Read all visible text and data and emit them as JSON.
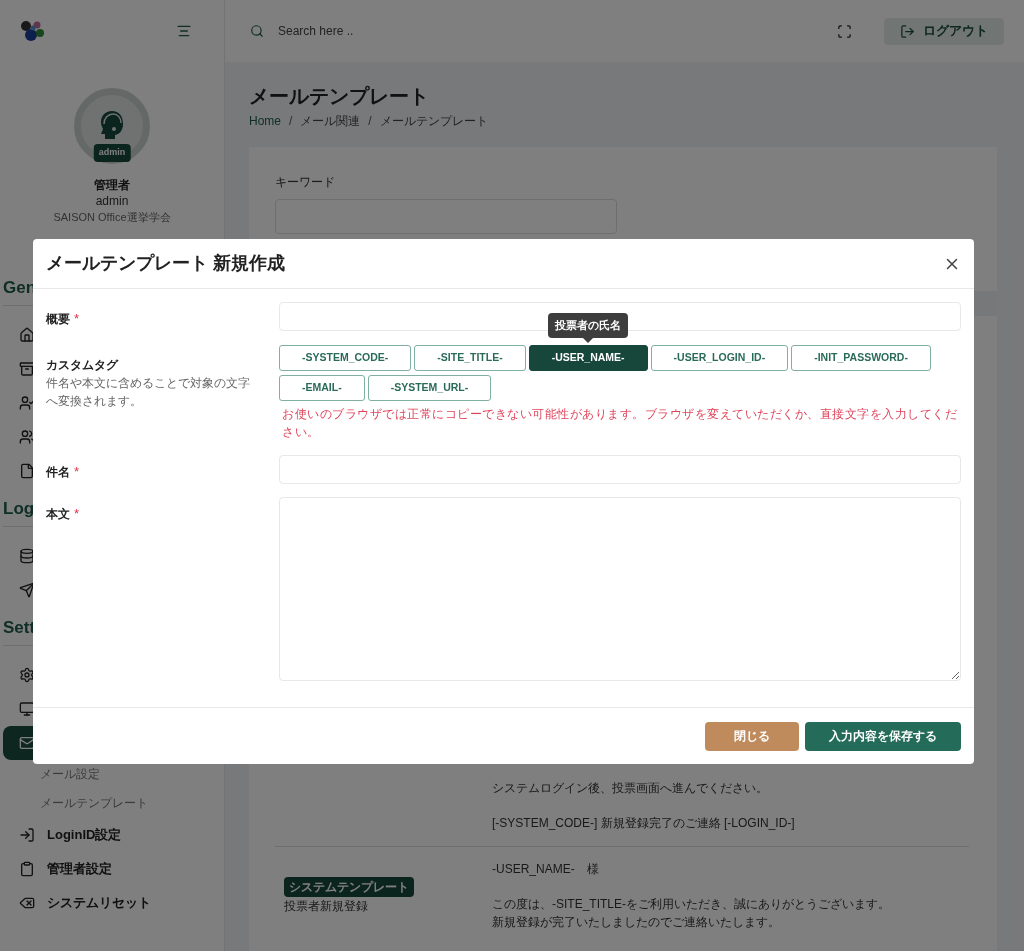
{
  "sidebar": {
    "profile": {
      "badge": "admin",
      "name": "管理者",
      "username": "admin",
      "organization": "SAISON Office選挙学会"
    },
    "sections": [
      {
        "title": "Gen",
        "items": [
          {
            "selected": false
          },
          {
            "selected": false
          },
          {
            "selected": false
          },
          {
            "selected": false
          },
          {
            "selected": false
          }
        ]
      },
      {
        "title": "Log",
        "items": [
          {
            "selected": false
          },
          {
            "selected": false
          }
        ]
      },
      {
        "title": "Sett",
        "items": [
          {
            "selected": false
          },
          {
            "selected": false
          },
          {
            "selected": true,
            "children": [
              {
                "label": "メール設定"
              },
              {
                "label": "メールテンプレート"
              }
            ]
          },
          {
            "label": "LoginID設定",
            "selected": false
          },
          {
            "label": "管理者設定",
            "selected": false
          },
          {
            "label": "システムリセット",
            "selected": false
          }
        ]
      }
    ]
  },
  "header": {
    "search_placeholder": "Search here ..",
    "logout": "ログアウト"
  },
  "page": {
    "title": "メールテンプレート",
    "breadcrumb": [
      "Home",
      "/",
      "メール関連",
      "/",
      "メールテンプレート"
    ],
    "filter_label": "キーワード",
    "rows": [
      {
        "paragraphs": [
          [
            "システムログイン後、投票画面へ進んでください。"
          ],
          [
            "[-SYSTEM_CODE-] 新規登録完了のご連絡 [-LOGIN_ID-]"
          ]
        ]
      },
      {
        "badge": "システムテンプレート",
        "name": "投票者新規登録",
        "paragraphs": [
          [
            "-USER_NAME-　様"
          ],
          [
            "この度は、-SITE_TITLE-をご利用いただき、誠にありがとうございます。",
            "新規登録が完了いたしましたのでご連絡いたします。"
          ]
        ]
      }
    ]
  },
  "modal": {
    "title": "メールテンプレート 新規作成",
    "required_mark": "*",
    "fields": [
      {
        "kind": "input",
        "label": "概要",
        "required": true
      },
      {
        "kind": "tags",
        "label": "カスタムタグ",
        "required": false,
        "hint": "件名や本文に含めることで対象の文字へ変換されます。",
        "tags": [
          {
            "label": "-SYSTEM_CODE-",
            "selected": false
          },
          {
            "label": "-SITE_TITLE-",
            "selected": false
          },
          {
            "label": "-USER_NAME-",
            "selected": true,
            "tooltip": "投票者の氏名"
          },
          {
            "label": "-USER_LOGIN_ID-",
            "selected": false
          },
          {
            "label": "-INIT_PASSWORD-",
            "selected": false
          },
          {
            "label": "-EMAIL-",
            "selected": false
          },
          {
            "label": "-SYSTEM_URL-",
            "selected": false
          }
        ],
        "warning": "お使いのブラウザでは正常にコピーできない可能性があります。ブラウザを変えていただくか、直接文字を入力してください。"
      },
      {
        "kind": "input",
        "label": "件名",
        "required": true
      },
      {
        "kind": "textarea",
        "label": "本文",
        "required": true
      }
    ],
    "buttons": [
      {
        "kind": "secondary",
        "label": "閉じる"
      },
      {
        "kind": "primary",
        "label": "入力内容を保存する"
      }
    ]
  }
}
